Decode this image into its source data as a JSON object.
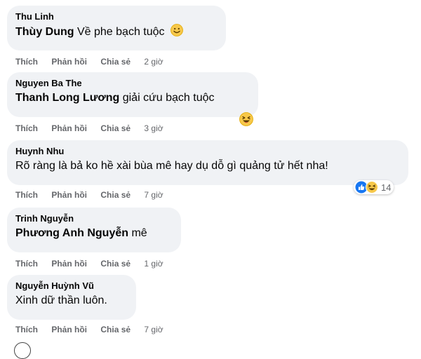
{
  "actions": {
    "like": "Thích",
    "reply": "Phản hồi",
    "share": "Chia sẻ"
  },
  "comments": [
    {
      "author": "Thu Linh",
      "tag": "Thùy Dung",
      "text": " Về phe bạch tuộc",
      "time": "2 giờ",
      "emoji": "smile-emoji"
    },
    {
      "author": "Nguyen Ba The",
      "tag": "Thanh Long Lương",
      "text": " giải cứu bạch tuộc",
      "time": "3 giờ",
      "emoji": "laughing-emoji"
    },
    {
      "author": "Huynh Nhu",
      "tag": "",
      "text": "Rõ ràng là bả ko hề xài bùa mê hay dụ dỗ gì quảng tử hết nha!",
      "time": "7 giờ",
      "reaction_count": "14",
      "reactions": [
        "like-reaction",
        "haha-reaction"
      ]
    },
    {
      "author": "Trinh Nguyễn",
      "tag": "Phương Anh Nguyễn",
      "text": " mê",
      "time": "1 giờ"
    },
    {
      "author": "Nguyễn Huỳnh Vũ",
      "tag": "",
      "text": "Xinh dữ thần luôn.",
      "time": "7 giờ"
    }
  ],
  "colors": {
    "bubble": "#f0f2f5",
    "meta": "#65676b",
    "like_blue": "#1877f2",
    "emoji_yellow": "#f7c84a"
  }
}
